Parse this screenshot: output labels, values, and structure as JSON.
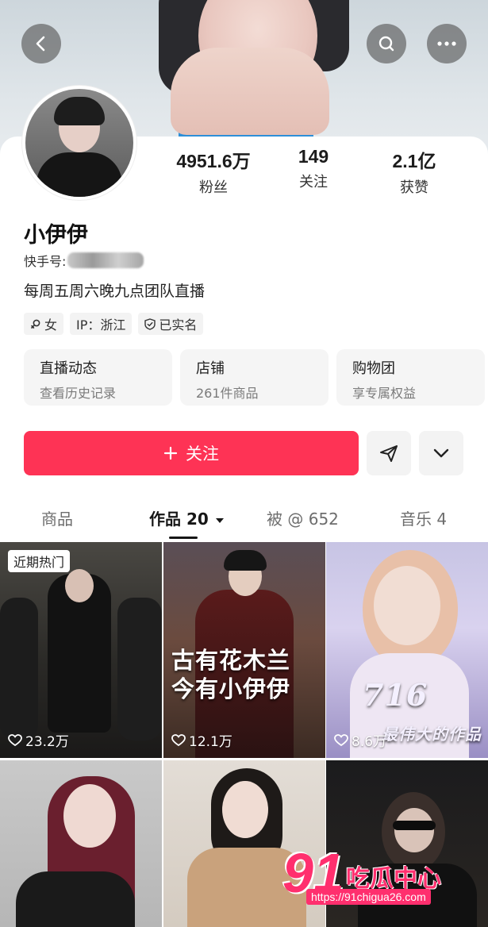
{
  "profile": {
    "name": "小伊伊",
    "kuaishou_id_label": "快手号:",
    "bio": "每周五周六晚九点团队直播",
    "tags": [
      {
        "icon": "female-icon",
        "label": "女"
      },
      {
        "icon": "",
        "label": "IP：浙江"
      },
      {
        "icon": "verified-shield-icon",
        "label": "已实名"
      }
    ]
  },
  "stats": [
    {
      "value": "4951.6万",
      "label": "粉丝"
    },
    {
      "value": "149",
      "label": "关注"
    },
    {
      "value": "2.1亿",
      "label": "获赞"
    }
  ],
  "cards": [
    {
      "title": "直播动态",
      "sub": "查看历史记录"
    },
    {
      "title": "店铺",
      "sub": "261件商品"
    },
    {
      "title": "购物团",
      "sub": "享专属权益"
    }
  ],
  "actions": {
    "follow_label": "关注",
    "follow_icon": "plus-icon",
    "share_icon": "send-icon",
    "more_icon": "chevron-down-icon"
  },
  "tabs": [
    {
      "label": "商品"
    },
    {
      "label": "作品 20"
    },
    {
      "label": "被 @ 652"
    },
    {
      "label": "音乐 4"
    }
  ],
  "videos": [
    {
      "badge": "近期热门",
      "likes": "23.2万",
      "caption_lines": []
    },
    {
      "badge": "",
      "likes": "12.1万",
      "caption_lines": [
        "古有花木兰",
        "今有小伊伊"
      ]
    },
    {
      "badge": "",
      "likes": "8.6万",
      "caption_lines": [
        "716",
        "最伟大的作品"
      ]
    },
    {
      "badge": "",
      "likes": "",
      "caption_lines": []
    },
    {
      "badge": "",
      "likes": "",
      "caption_lines": []
    },
    {
      "badge": "",
      "likes": "",
      "caption_lines": []
    }
  ],
  "watermark": {
    "num": "91",
    "text": "吃瓜中心",
    "url": "https://91chigua26.com"
  },
  "colors": {
    "accent": "#fe3355",
    "watermark": "#ff2f6e"
  },
  "nav": {
    "back_icon": "back-arrow-icon",
    "search_icon": "search-icon",
    "more_icon": "more-dots-icon"
  }
}
